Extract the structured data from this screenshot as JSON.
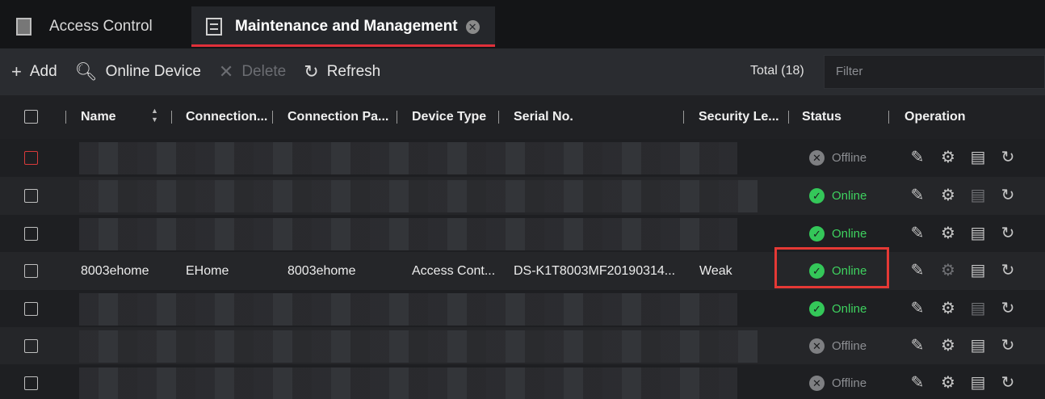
{
  "tabs": [
    {
      "label": "Access Control"
    },
    {
      "label": "Maintenance and Management"
    }
  ],
  "toolbar": {
    "add": "Add",
    "online_device": "Online Device",
    "delete": "Delete",
    "refresh": "Refresh",
    "total": "Total (18)",
    "filter_placeholder": "Filter"
  },
  "columns": [
    "Name",
    "Connection...",
    "Connection Pa...",
    "Device Type",
    "Serial No.",
    "Security Le...",
    "Status",
    "Operation"
  ],
  "rows": [
    {
      "status": "Offline"
    },
    {
      "status": "Online"
    },
    {
      "status": "Online"
    },
    {
      "name": "8003ehome",
      "connection": "EHome",
      "connection_param": "8003ehome",
      "device_type": "Access Cont...",
      "serial": "DS-K1T8003MF20190314...",
      "security": "Weak",
      "status": "Online"
    },
    {
      "status": "Online"
    },
    {
      "status": "Offline"
    },
    {
      "status": "Offline"
    }
  ],
  "colors": {
    "online": "#3ed25f",
    "offline": "#8c8e92",
    "accent": "#e0303a"
  }
}
